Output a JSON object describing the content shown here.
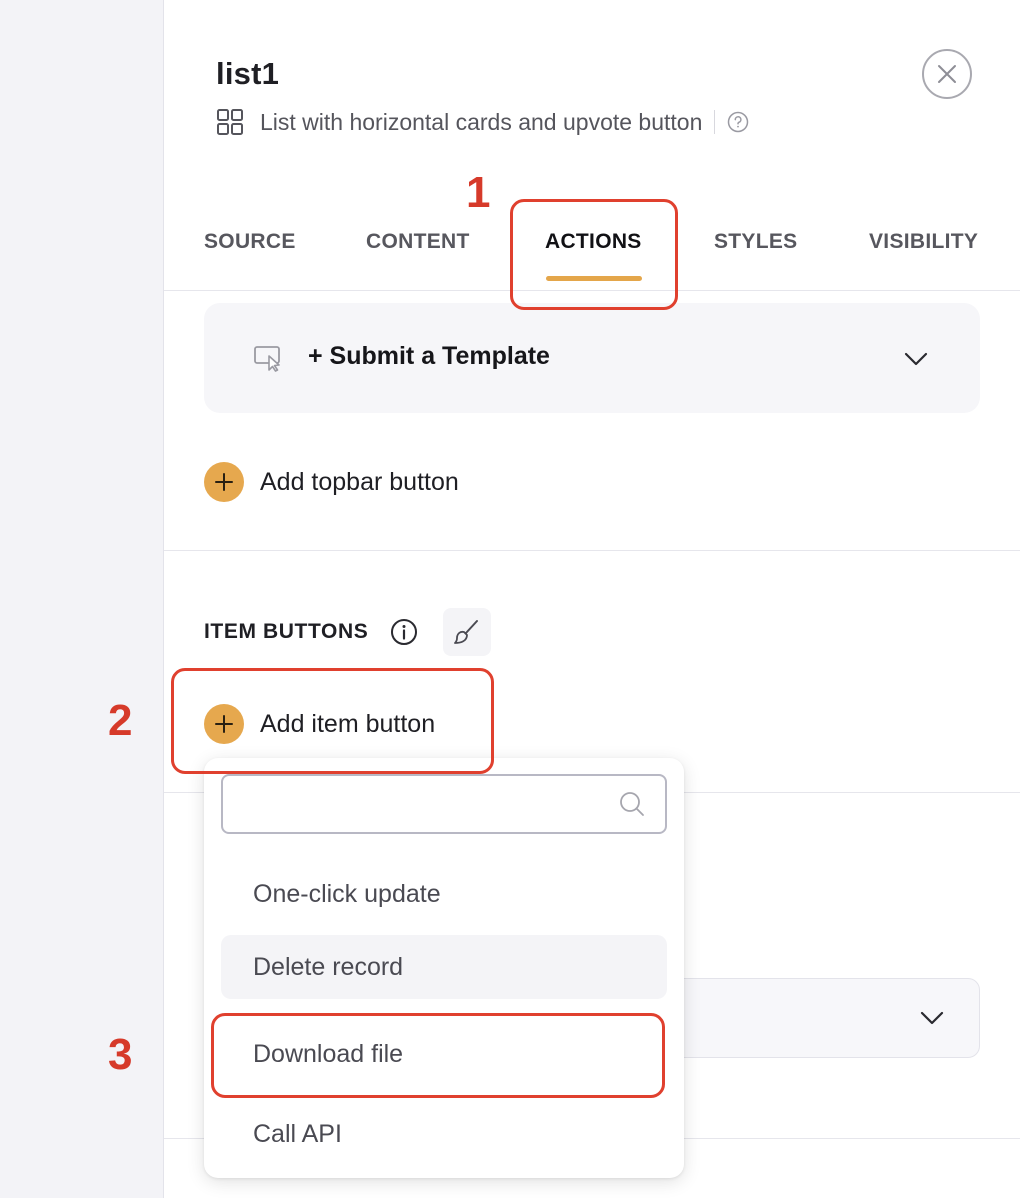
{
  "header": {
    "title": "list1",
    "subtitle": "List with horizontal cards and upvote button",
    "grid_icon": "grid-icon",
    "help_icon": "question-circle-icon",
    "close_icon": "close-icon"
  },
  "tabs": [
    {
      "label": "SOURCE",
      "active": false
    },
    {
      "label": "CONTENT",
      "active": false
    },
    {
      "label": "ACTIONS",
      "active": true
    },
    {
      "label": "STYLES",
      "active": false
    },
    {
      "label": "VISIBILITY",
      "active": false
    }
  ],
  "template_card": {
    "label": "+ Submit a Template",
    "icon": "cursor-screen-icon"
  },
  "topbar": {
    "add_label": "Add topbar button"
  },
  "item_buttons": {
    "section_title": "ITEM BUTTONS",
    "add_label": "Add item button"
  },
  "dropdown": {
    "search_value": "",
    "search_placeholder": "",
    "items": [
      {
        "label": "One-click update"
      },
      {
        "label": "Delete record"
      },
      {
        "label": "Download file"
      },
      {
        "label": "Call API"
      }
    ]
  },
  "annotations": {
    "step1": "1",
    "step2": "2",
    "step3": "3"
  },
  "colors": {
    "accent": "#e4a64a",
    "callout": "#e0402e",
    "callout_text": "#d63a2a"
  }
}
